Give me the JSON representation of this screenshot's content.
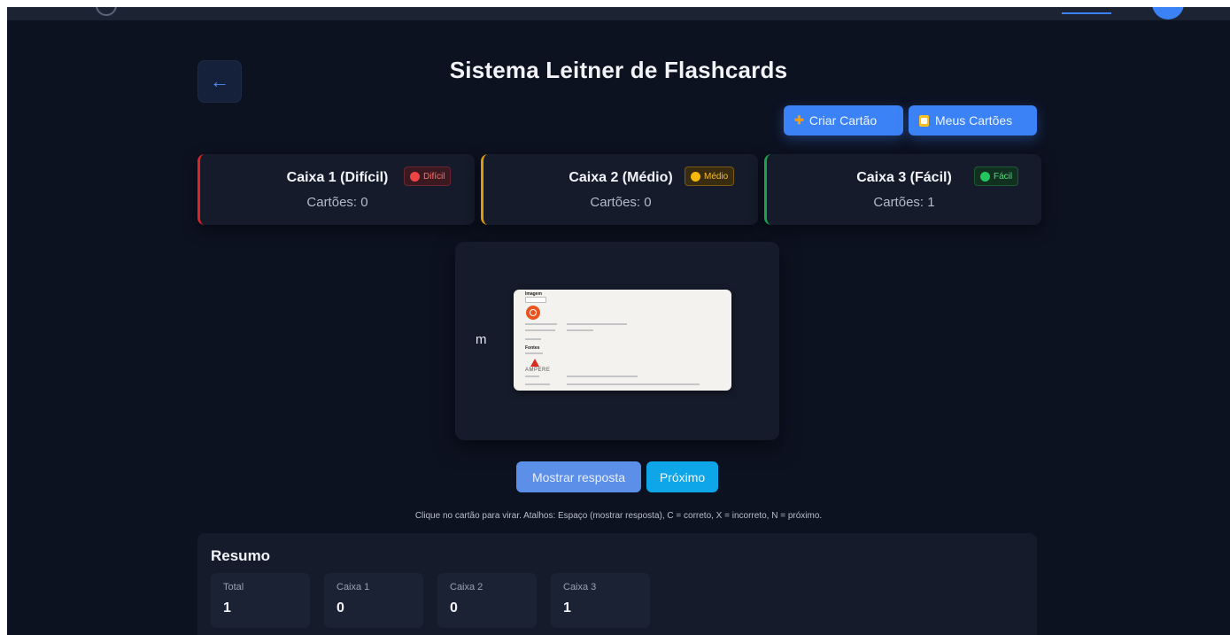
{
  "header": {
    "title": "Sistema Leitner de Flashcards",
    "back_icon": "arrow-left-icon",
    "back_glyph": "←"
  },
  "actions": {
    "create_label": "Criar Cartão",
    "create_icon": "plus-icon",
    "my_cards_label": "Meus Cartões",
    "my_cards_icon": "clipboard-icon"
  },
  "boxes": [
    {
      "title": "Caixa 1 (Difícil)",
      "badge": "Difícil",
      "count_label": "Cartões: 0",
      "color": "#dc2626"
    },
    {
      "title": "Caixa 2 (Médio)",
      "badge": "Médio",
      "count_label": "Cartões: 0",
      "color": "#d99a0e"
    },
    {
      "title": "Caixa 3 (Fácil)",
      "badge": "Fácil",
      "count_label": "Cartões: 1",
      "color": "#16a34a"
    }
  ],
  "card": {
    "front_text": "m",
    "image_heading": "Imagem",
    "image_section": "Fontes",
    "image_brand": "AMPERE"
  },
  "controls": {
    "show_answer_label": "Mostrar resposta",
    "next_label": "Próximo",
    "hint": "Clique no cartão para virar. Atalhos: Espaço (mostrar resposta), C = correto, X = incorreto, N = próximo."
  },
  "summary": {
    "title": "Resumo",
    "stats": [
      {
        "label": "Total",
        "value": "1"
      },
      {
        "label": "Caixa 1",
        "value": "0"
      },
      {
        "label": "Caixa 2",
        "value": "0"
      },
      {
        "label": "Caixa 3",
        "value": "1"
      }
    ]
  },
  "colors": {
    "background": "#0d1221",
    "panel": "#151b2b",
    "accent": "#3b82f6",
    "next_button": "#0ea5e9"
  }
}
